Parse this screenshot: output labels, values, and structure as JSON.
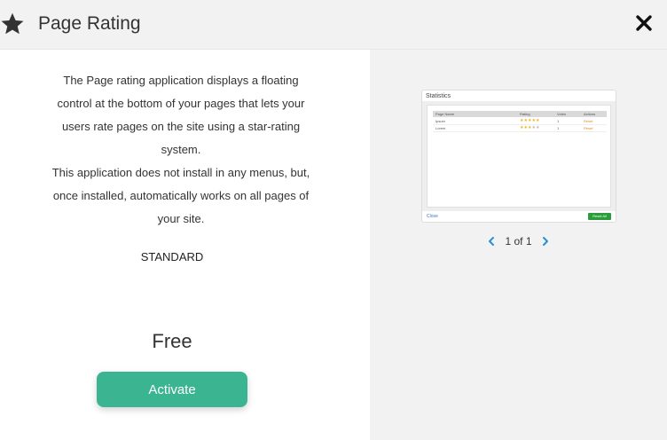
{
  "header": {
    "title": "Page Rating",
    "icon": "star-icon",
    "close_icon": "close-icon"
  },
  "description": {
    "lines": [
      "The Page rating application displays a floating",
      "control at the bottom of your pages that lets your",
      "users rate pages on the site using a star-rating",
      "system.",
      "This application does not install in any menus, but,",
      "once installed, automatically works on all pages of",
      "your site."
    ]
  },
  "edition": "STANDARD",
  "price": "Free",
  "activate_label": "Activate",
  "preview": {
    "title": "Statistics",
    "columns": [
      "Page Name",
      "Rating",
      "Votes",
      "Actions"
    ],
    "rows": [
      {
        "name": "Ipsum",
        "stars_filled": 5,
        "votes": "1",
        "action": "Reset"
      },
      {
        "name": "Lorem",
        "stars_filled": 3,
        "votes": "1",
        "action": "Reset"
      }
    ],
    "close_label": "Close",
    "button_label": "Reset All",
    "star_color": "#f0b429",
    "star_empty_color": "#bbbbbb"
  },
  "pager": {
    "text": "1 of 1",
    "prev_icon": "chevron-left-icon",
    "next_icon": "chevron-right-icon",
    "accent": "#2a8fd6"
  }
}
